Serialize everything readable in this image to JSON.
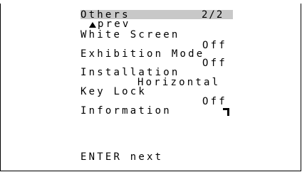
{
  "menu": {
    "title": "Others",
    "page": "2/2",
    "prev_label": "prev",
    "items": [
      {
        "label": "White Screen",
        "value": "Off"
      },
      {
        "label": "Exhibition Mode",
        "value": "Off"
      },
      {
        "label": "Installation",
        "value": "Horizontal"
      },
      {
        "label": "Key Lock",
        "value": "Off"
      },
      {
        "label": "Information"
      }
    ]
  },
  "footer": {
    "hint": "ENTER next"
  },
  "colors": {
    "header_highlight": "#c8c8c8",
    "text": "#000000"
  },
  "icons": {
    "selection_cursor": "corner-cursor-icon",
    "prev": "up-triangle-icon"
  }
}
